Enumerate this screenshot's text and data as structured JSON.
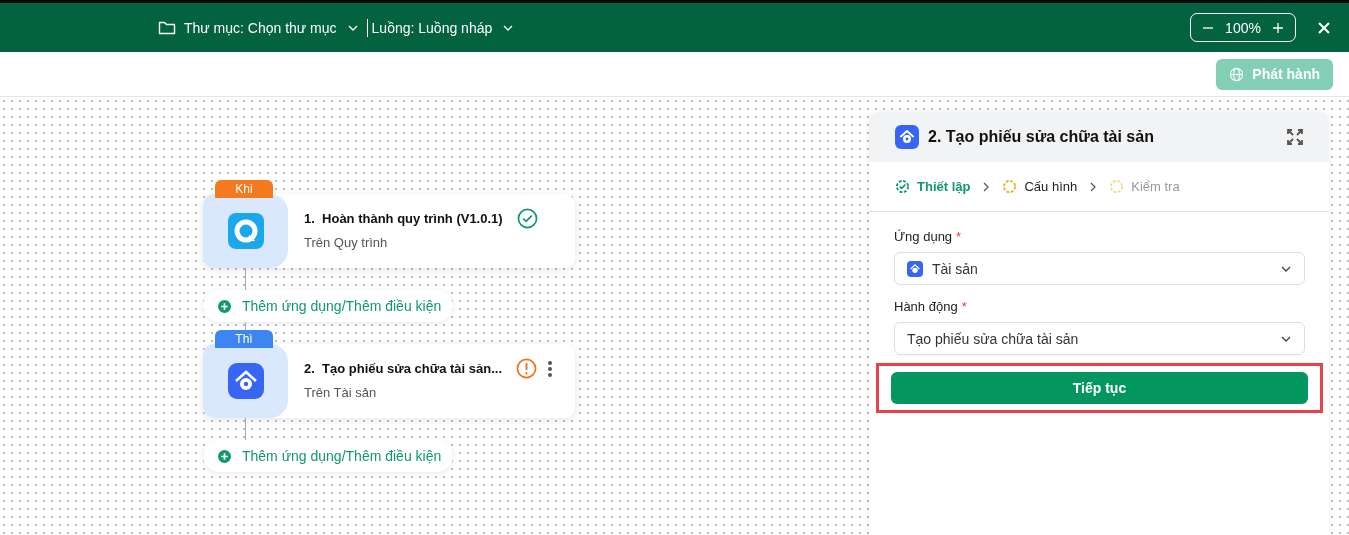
{
  "topbar": {
    "folder": "Thư mục: Chọn thư mục",
    "flow": "Luồng: Luồng nháp",
    "zoom": "100%"
  },
  "publish_button": {
    "label": "Phát hành",
    "disabled": true
  },
  "nodes": [
    {
      "badge": "Khi",
      "kind": "trigger",
      "title": "1.  Hoàn thành quy trình (V1.0.1)",
      "subtitle": "Trên Quy trình",
      "valid": true,
      "menu": false,
      "add_label": "Thêm ứng dụng/Thêm điều kiện"
    },
    {
      "badge": "Thì",
      "kind": "action",
      "title": "2.  Tạo phiếu sửa chữa tài sản...",
      "subtitle": "Trên Tài sản",
      "valid": false,
      "menu": true,
      "add_label": "Thêm ứng dụng/Thêm điều kiện"
    }
  ],
  "panel": {
    "title": "2. Tạo phiếu sửa chữa tài sản",
    "steps": [
      {
        "label": "Thiết lập",
        "kind": "done"
      },
      {
        "label": "Cấu hình",
        "kind": "current"
      },
      {
        "label": "Kiểm tra",
        "kind": "pending"
      }
    ],
    "fields": [
      {
        "label": "Ứng dụng",
        "required_mark": "*",
        "value": "Tài sản",
        "icon": true
      },
      {
        "label": "Hành động",
        "required_mark": "*",
        "value": "Tạo phiếu sửa chữa tài sản",
        "icon": false
      }
    ],
    "button": {
      "label": "Tiếp tục",
      "highlighted": true
    }
  }
}
